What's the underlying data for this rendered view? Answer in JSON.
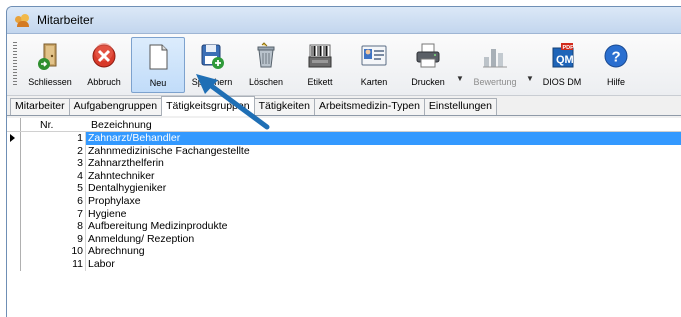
{
  "window": {
    "title": "Mitarbeiter"
  },
  "toolbar": {
    "buttons": [
      {
        "label": "Schliessen",
        "icon": "exit-door-icon"
      },
      {
        "label": "Abbruch",
        "icon": "cancel-icon"
      },
      {
        "label": "Neu",
        "icon": "new-document-icon",
        "active": true
      },
      {
        "label": "Speichern",
        "icon": "save-icon"
      },
      {
        "label": "Löschen",
        "icon": "trash-icon"
      },
      {
        "label": "Etikett",
        "icon": "barcode-label-icon"
      },
      {
        "label": "Karten",
        "icon": "contact-card-icon"
      },
      {
        "label": "Drucken",
        "icon": "printer-icon"
      },
      {
        "label": "Bewertung",
        "icon": "rating-chart-icon",
        "disabled": true
      },
      {
        "label": "DIOS DM",
        "icon": "qm-pdf-icon"
      },
      {
        "label": "Hilfe",
        "icon": "help-icon"
      }
    ]
  },
  "tabs": [
    "Mitarbeiter",
    "Aufgabengruppen",
    "Tätigkeitsgruppen",
    "Tätigkeiten",
    "Arbeitsmedizin-Typen",
    "Einstellungen"
  ],
  "active_tab": "Tätigkeitsgruppen",
  "table": {
    "columns": [
      "Nr.",
      "Bezeichnung"
    ],
    "rows": [
      {
        "nr": "1",
        "bezeichnung": "Zahnarzt/Behandler"
      },
      {
        "nr": "2",
        "bezeichnung": "Zahnmedizinische Fachangestellte"
      },
      {
        "nr": "3",
        "bezeichnung": "Zahnarzthelferin"
      },
      {
        "nr": "4",
        "bezeichnung": "Zahntechniker"
      },
      {
        "nr": "5",
        "bezeichnung": "Dentalhygieniker"
      },
      {
        "nr": "6",
        "bezeichnung": "Prophylaxe"
      },
      {
        "nr": "7",
        "bezeichnung": "Hygiene"
      },
      {
        "nr": "8",
        "bezeichnung": "Aufbereitung Medizinprodukte"
      },
      {
        "nr": "9",
        "bezeichnung": "Anmeldung/ Rezeption"
      },
      {
        "nr": "10",
        "bezeichnung": "Abrechnung"
      },
      {
        "nr": "11",
        "bezeichnung": "Labor"
      }
    ],
    "selected_row": 0
  },
  "colors": {
    "selection": "#3399ff",
    "annotation_arrow": "#1f6fb5"
  }
}
